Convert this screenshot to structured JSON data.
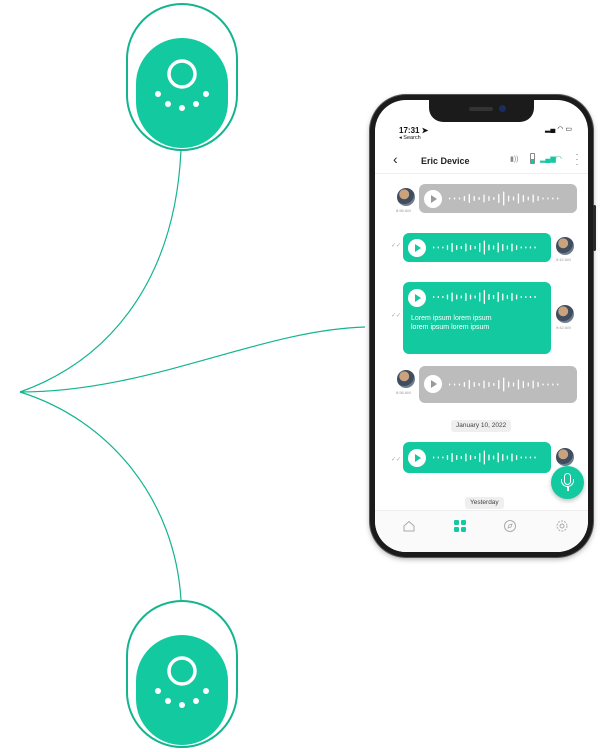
{
  "status_bar": {
    "time": "17:31 ➤",
    "back_label": "◂ Search",
    "icons": "▂▄ ◠ ▭"
  },
  "header": {
    "back_icon": "chevron-left-icon",
    "title": "Eric Device",
    "volume_icon": "▮))",
    "signal_icon": "▂▄▆",
    "wifi_icon": "◠",
    "more_icon": "⋮"
  },
  "messages": [
    {
      "direction": "incoming",
      "type": "audio",
      "time": "8:56 AM"
    },
    {
      "direction": "outgoing",
      "type": "audio",
      "time": "9:42 AM",
      "ticks": "✓✓"
    },
    {
      "direction": "outgoing",
      "type": "audio",
      "time": "9:42 AM",
      "ticks": "✓✓",
      "text": "Lorem ipsum lorem ipsum lorem ipsum lorem ipsum"
    },
    {
      "direction": "incoming",
      "type": "audio",
      "time": "8:56 AM"
    },
    {
      "direction": "outgoing",
      "type": "audio",
      "time": "",
      "ticks": "✓✓"
    }
  ],
  "date_separators": [
    "January 10, 2022",
    "Yesterday"
  ],
  "tab_bar": [
    "home-icon",
    "grid-icon",
    "compass-icon",
    "settings-icon"
  ],
  "colors": {
    "accent": "#13c9a0",
    "bubble_grey": "#bcbcbc",
    "outline": "#13b58f"
  }
}
